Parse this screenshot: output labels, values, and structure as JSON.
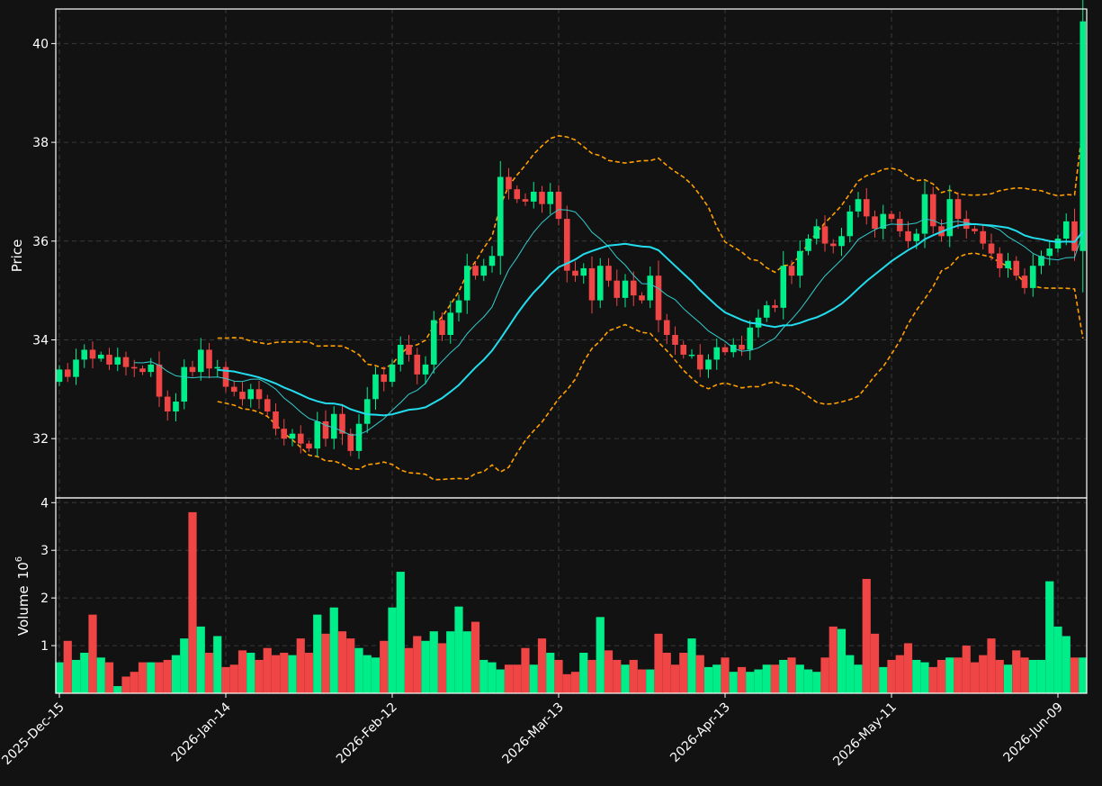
{
  "chart_data": {
    "type": "candlestick",
    "ylabel_price": "Price",
    "ylabel_volume": "Volume",
    "volume_exponent_label": "10",
    "volume_exponent": "6",
    "x_tick_labels": [
      "2025-Dec-15",
      "2026-Jan-14",
      "2026-Feb-12",
      "2026-Mar-13",
      "2026-Apr-13",
      "2026-May-11",
      "2026-Jun-09"
    ],
    "x_tick_index": [
      0,
      20,
      40,
      60,
      80,
      100,
      120
    ],
    "price_yticks": [
      32,
      34,
      36,
      38,
      40
    ],
    "price_ylim": [
      30.8,
      40.7
    ],
    "volume_yticks": [
      1,
      2,
      3,
      4
    ],
    "volume_ylim": [
      0,
      4.1
    ],
    "n_bars": 124,
    "colors": {
      "up": "#00ee8a",
      "down": "#f04545",
      "ma_long": "#22ddee",
      "ma_short": "#33cccc",
      "bands": "#ff9f00",
      "background": "#121212",
      "grid": "#3a3a3a"
    },
    "closes": [
      33.4,
      33.25,
      33.6,
      33.8,
      33.62,
      33.7,
      33.5,
      33.65,
      33.45,
      33.42,
      33.35,
      33.5,
      32.85,
      32.55,
      32.75,
      33.45,
      33.35,
      33.8,
      33.42,
      33.45,
      33.05,
      32.95,
      32.8,
      33.0,
      32.8,
      32.55,
      32.2,
      32.0,
      32.1,
      31.9,
      31.8,
      32.35,
      32.0,
      32.5,
      32.1,
      31.75,
      32.3,
      32.8,
      33.3,
      33.15,
      33.5,
      33.9,
      33.7,
      33.3,
      33.5,
      34.4,
      34.1,
      34.55,
      34.8,
      35.5,
      35.3,
      35.5,
      35.7,
      37.3,
      37.05,
      36.85,
      36.8,
      37.0,
      36.75,
      37.0,
      36.45,
      35.4,
      35.3,
      35.45,
      34.8,
      35.5,
      35.2,
      34.85,
      35.2,
      34.9,
      34.8,
      35.3,
      34.4,
      34.1,
      33.9,
      33.7,
      33.7,
      33.4,
      33.6,
      33.85,
      33.75,
      33.9,
      33.8,
      34.25,
      34.45,
      34.7,
      34.65,
      35.5,
      35.3,
      35.8,
      36.05,
      36.3,
      35.95,
      35.9,
      36.1,
      36.6,
      36.85,
      36.5,
      36.25,
      36.55,
      36.45,
      36.2,
      36.0,
      36.15,
      36.95,
      36.3,
      36.1,
      36.85,
      36.45,
      36.25,
      36.2,
      35.95,
      35.75,
      35.45,
      35.6,
      35.3,
      35.05,
      35.5,
      35.7,
      35.85,
      36.05,
      36.4,
      35.8,
      40.45
    ],
    "volumes": [
      0.65,
      1.1,
      0.7,
      0.85,
      1.65,
      0.75,
      0.65,
      0.15,
      0.35,
      0.45,
      0.65,
      0.65,
      0.65,
      0.7,
      0.8,
      1.15,
      3.8,
      1.4,
      0.85,
      1.2,
      0.55,
      0.6,
      0.9,
      0.85,
      0.7,
      0.95,
      0.8,
      0.85,
      0.8,
      1.15,
      0.85,
      1.65,
      1.25,
      1.8,
      1.3,
      1.15,
      0.95,
      0.8,
      0.75,
      1.1,
      1.8,
      2.55,
      0.95,
      1.2,
      1.1,
      1.3,
      1.05,
      1.3,
      1.82,
      1.3,
      1.5,
      0.7,
      0.65,
      0.5,
      0.6,
      0.6,
      0.95,
      0.6,
      1.15,
      0.85,
      0.7,
      0.4,
      0.45,
      0.85,
      0.7,
      1.6,
      0.9,
      0.7,
      0.6,
      0.7,
      0.5,
      0.5,
      1.25,
      0.85,
      0.6,
      0.85,
      1.15,
      0.8,
      0.55,
      0.6,
      0.75,
      0.45,
      0.55,
      0.45,
      0.5,
      0.6,
      0.6,
      0.7,
      0.75,
      0.6,
      0.5,
      0.45,
      0.75,
      1.4,
      1.35,
      0.8,
      0.6,
      2.4,
      1.25,
      0.55,
      0.7,
      0.8,
      1.05,
      0.7,
      0.65,
      0.55,
      0.7,
      0.75,
      0.75,
      1.0,
      0.65,
      0.8,
      1.15,
      0.7,
      0.6,
      0.9,
      0.75,
      0.7,
      0.7,
      2.35,
      1.4,
      1.2,
      0.75,
      0.75
    ]
  }
}
